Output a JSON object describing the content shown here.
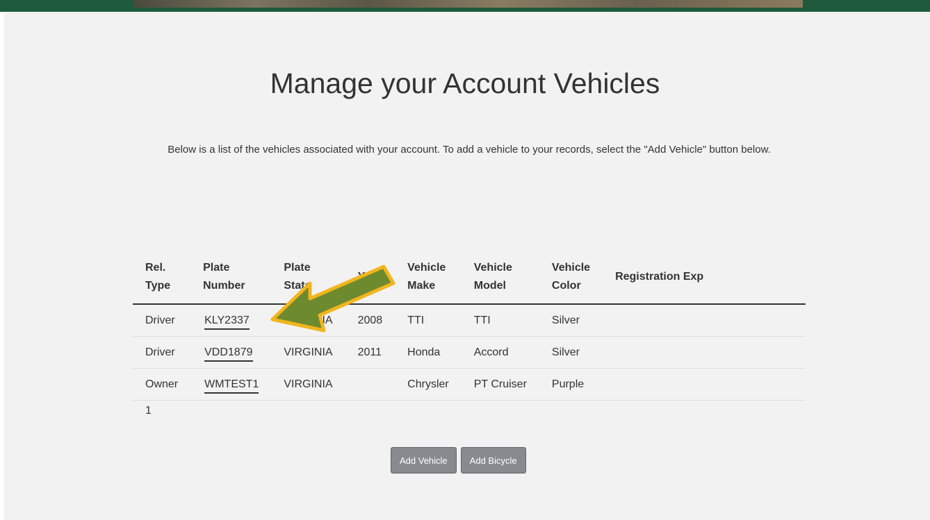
{
  "page": {
    "title": "Manage your Account Vehicles",
    "intro": "Below is a list of the vehicles associated with your account. To add a vehicle to your records, select the \"Add Vehicle\" button below."
  },
  "table": {
    "headers": {
      "rel_type": "Rel. Type",
      "plate_number": "Plate Number",
      "plate_state": "Plate State",
      "year": "Year",
      "vehicle_make": "Vehicle Make",
      "vehicle_model": "Vehicle Model",
      "vehicle_color": "Vehicle Color",
      "registration_exp": "Registration Exp"
    },
    "rows": [
      {
        "rel_type": "Driver",
        "plate_number": "KLY2337",
        "plate_state": "VIRGINIA",
        "year": "2008",
        "make": "TTI",
        "model": "TTI",
        "color": "Silver",
        "registration_exp": ""
      },
      {
        "rel_type": "Driver",
        "plate_number": "VDD1879",
        "plate_state": "VIRGINIA",
        "year": "2011",
        "make": "Honda",
        "model": "Accord",
        "color": "Silver",
        "registration_exp": ""
      },
      {
        "rel_type": "Owner",
        "plate_number": "WMTEST1",
        "plate_state": "VIRGINIA",
        "year": "",
        "make": "Chrysler",
        "model": "PT Cruiser",
        "color": "Purple",
        "registration_exp": ""
      }
    ]
  },
  "pagination": {
    "current_page": "1"
  },
  "buttons": {
    "add_vehicle": "Add Vehicle",
    "add_bicycle": "Add Bicycle"
  },
  "colors": {
    "banner": "#1f5a3c",
    "page_background": "#f2f2f2",
    "button": "#878b90",
    "arrow_fill": "#6e8a2e",
    "arrow_outline": "#f2b51d"
  },
  "annotation": {
    "icon": "arrow-pointer-icon"
  }
}
